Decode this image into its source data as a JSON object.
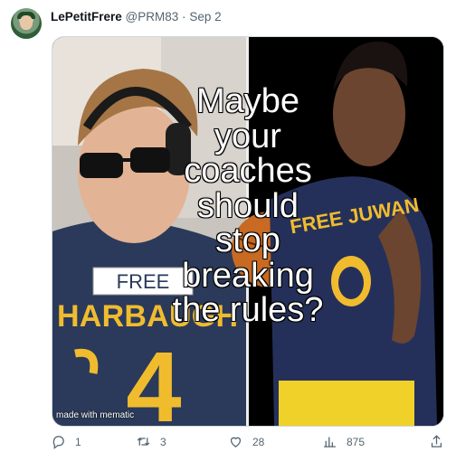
{
  "tweet": {
    "author_name": "LePetitFrere",
    "handle": "@PRM83",
    "separator": "·",
    "date": "Sep 2",
    "more_icon": "more-dots-icon"
  },
  "media": {
    "caption": "Maybe\nyour\ncoaches\nshould\nstop\nbreaking\nthe rules?",
    "watermark": "made with mematic",
    "left_shirt_tag": "FREE",
    "left_shirt_text": "HARBAUGH",
    "left_number": "4",
    "right_shirt_text": "FREE JUWAN"
  },
  "actions": {
    "reply_count": "1",
    "retweet_count": "3",
    "like_count": "28",
    "views_count": "875"
  }
}
